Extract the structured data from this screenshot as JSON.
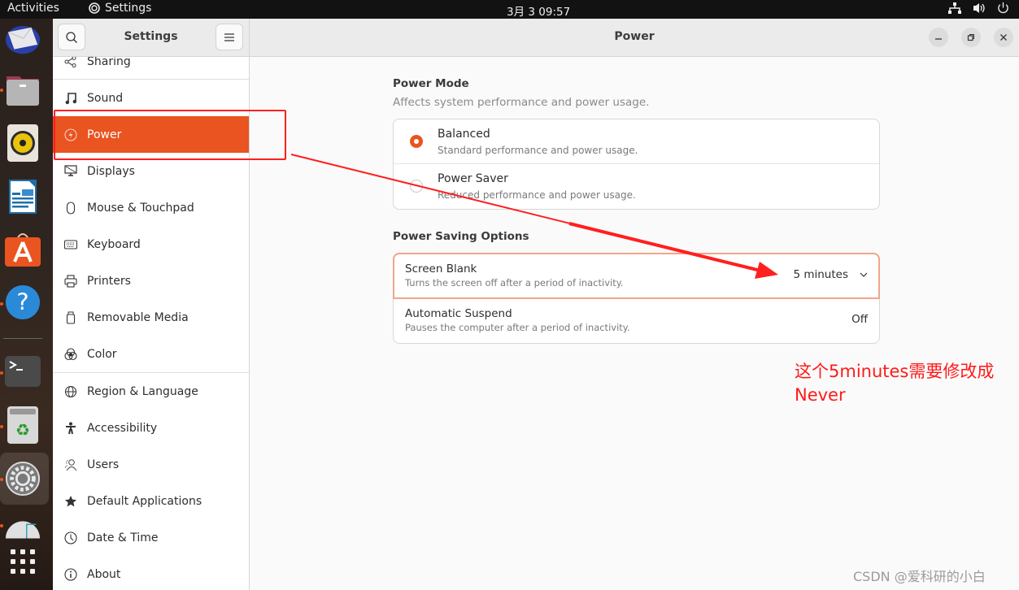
{
  "topbar": {
    "activities": "Activities",
    "app_name": "Settings",
    "clock": "3月 3  09:57",
    "tray_icons": [
      "network-icon",
      "volume-icon",
      "power-icon"
    ]
  },
  "dock": {
    "apps": [
      "thunderbird",
      "files",
      "rhythmbox",
      "libreoffice-writer",
      "app-center",
      "help",
      "terminal",
      "trash",
      "settings",
      "disk-usage",
      "show-apps"
    ]
  },
  "window": {
    "sidebar_title": "Settings",
    "page_title": "Power",
    "controls": {
      "minimize": "–",
      "maximize": "❐",
      "close": "✕"
    }
  },
  "sidebar": {
    "items": [
      {
        "label": "Sharing",
        "icon": "share-icon"
      },
      {
        "label": "Sound",
        "icon": "music-note-icon"
      },
      {
        "label": "Power",
        "icon": "power-bolt-icon",
        "active": true
      },
      {
        "label": "Displays",
        "icon": "display-icon"
      },
      {
        "label": "Mouse & Touchpad",
        "icon": "mouse-icon"
      },
      {
        "label": "Keyboard",
        "icon": "keyboard-icon"
      },
      {
        "label": "Printers",
        "icon": "printer-icon"
      },
      {
        "label": "Removable Media",
        "icon": "usb-icon"
      },
      {
        "label": "Color",
        "icon": "color-icon"
      },
      {
        "label": "Region & Language",
        "icon": "globe-icon"
      },
      {
        "label": "Accessibility",
        "icon": "accessibility-icon"
      },
      {
        "label": "Users",
        "icon": "users-icon"
      },
      {
        "label": "Default Applications",
        "icon": "star-icon"
      },
      {
        "label": "Date & Time",
        "icon": "clock-icon"
      },
      {
        "label": "About",
        "icon": "info-icon"
      }
    ]
  },
  "power_mode": {
    "title": "Power Mode",
    "subtitle": "Affects system performance and power usage.",
    "options": [
      {
        "label": "Balanced",
        "desc": "Standard performance and power usage.",
        "selected": true
      },
      {
        "label": "Power Saver",
        "desc": "Reduced performance and power usage.",
        "selected": false
      }
    ]
  },
  "power_saving": {
    "title": "Power Saving Options",
    "rows": [
      {
        "label": "Screen Blank",
        "desc": "Turns the screen off after a period of inactivity.",
        "value": "5 minutes"
      },
      {
        "label": "Automatic Suspend",
        "desc": "Pauses the computer after a period of inactivity.",
        "value": "Off"
      }
    ]
  },
  "annotation": {
    "line1": "这个5minutes需要修改成",
    "line2": "Never",
    "color": "#ff1a1a"
  },
  "watermark": "CSDN @爱科研的小白",
  "colors": {
    "accent": "#e95420",
    "annotation": "#ff1f1f"
  }
}
